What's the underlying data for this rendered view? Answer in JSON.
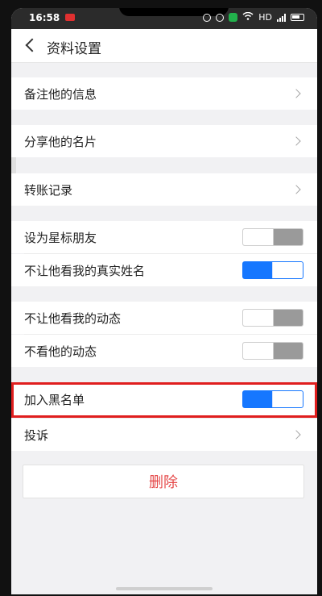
{
  "status_bar": {
    "time": "16:58",
    "network": "HD"
  },
  "header": {
    "title": "资料设置"
  },
  "rows": {
    "remark": "备注他的信息",
    "share": "分享他的名片",
    "transfer": "转账记录",
    "star": "设为星标朋友",
    "hide_name": "不让他看我的真实姓名",
    "hide_moments": "不让他看我的动态",
    "ignore_moments": "不看他的动态",
    "blacklist": "加入黑名单",
    "report": "投诉"
  },
  "toggles": {
    "star": false,
    "hide_name": true,
    "hide_moments": false,
    "ignore_moments": false,
    "blacklist": true
  },
  "delete_label": "删除",
  "colors": {
    "accent": "#1677ff",
    "danger": "#e54848",
    "highlight": "#e01e1e"
  }
}
